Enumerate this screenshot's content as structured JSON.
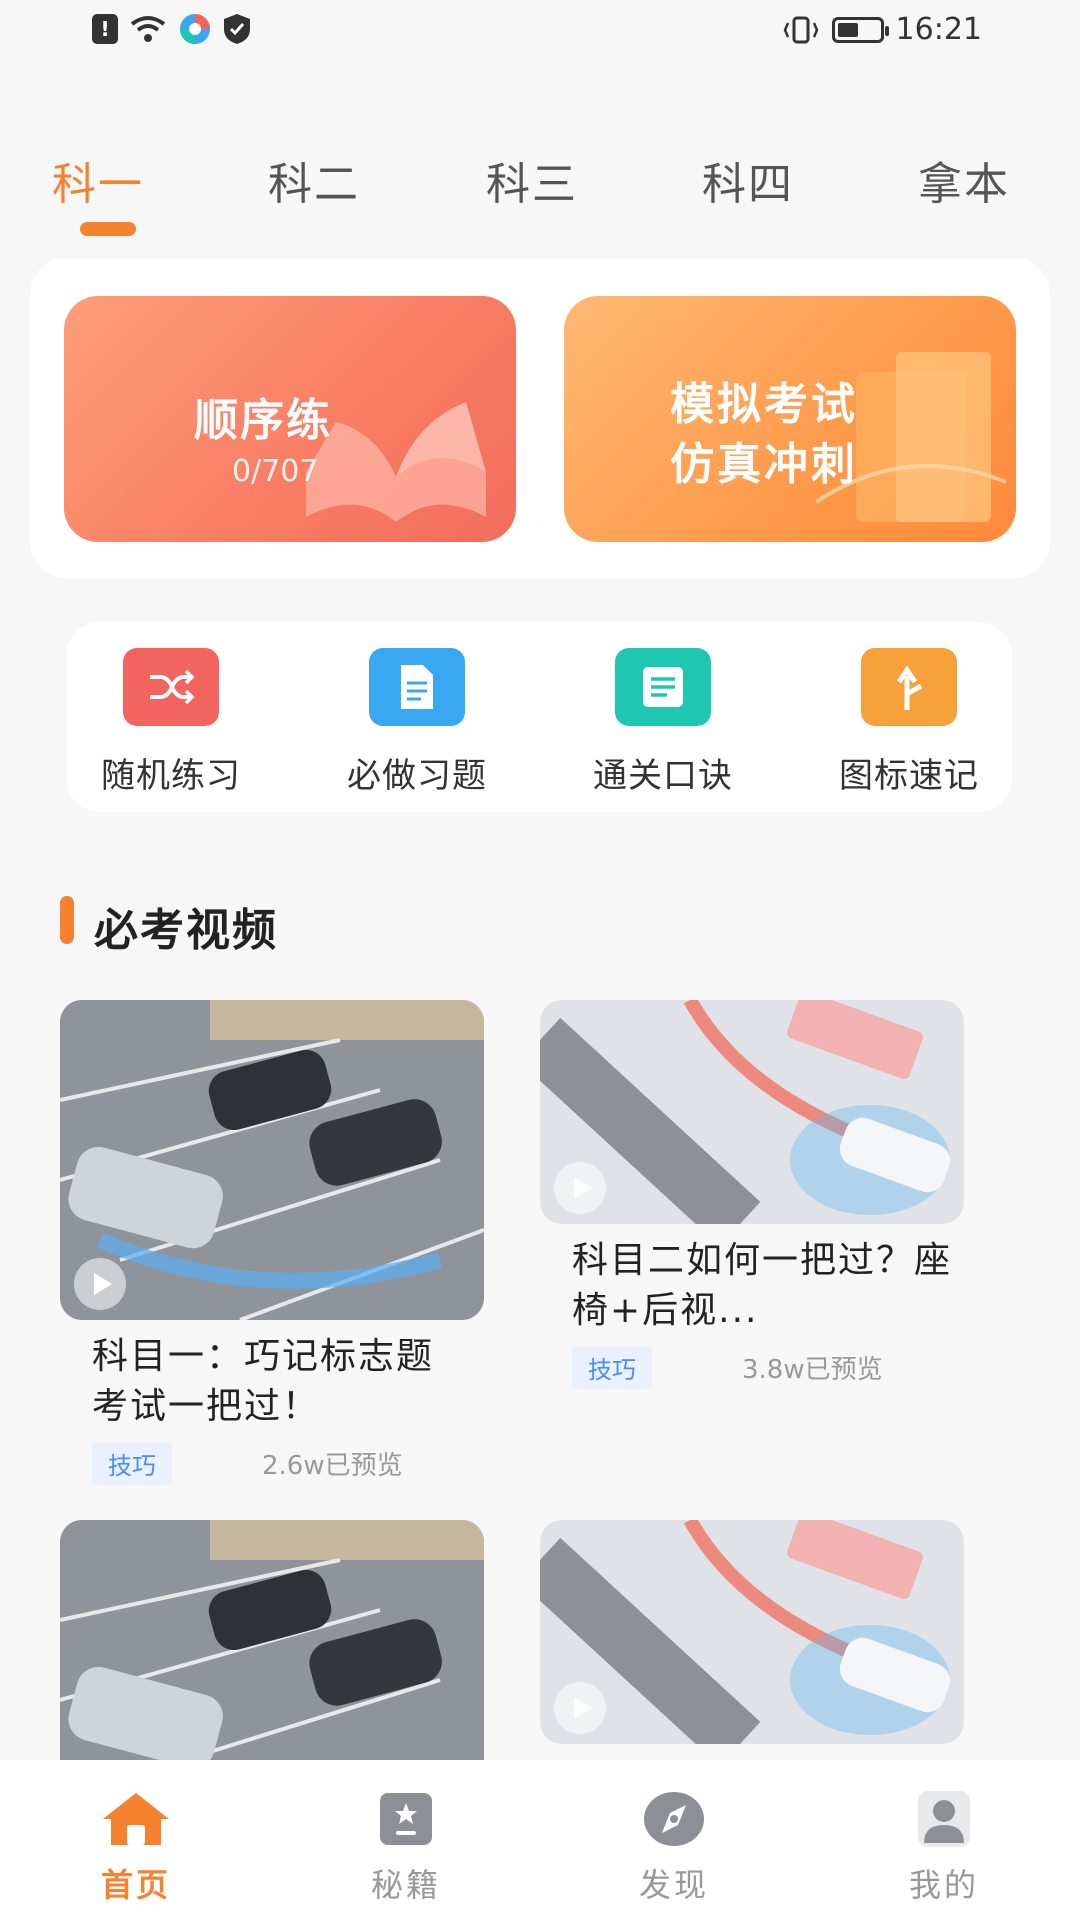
{
  "status_bar": {
    "time": "16:21",
    "icons": [
      "alert-icon",
      "wifi-icon",
      "app-icon",
      "shield-icon",
      "vibrate-icon",
      "battery-icon"
    ]
  },
  "tabs": [
    {
      "label": "科一",
      "active": true
    },
    {
      "label": "科二",
      "active": false
    },
    {
      "label": "科三",
      "active": false
    },
    {
      "label": "科四",
      "active": false
    },
    {
      "label": "拿本",
      "active": false
    }
  ],
  "cards": {
    "sequential": {
      "title": "顺序练",
      "count": "0/707"
    },
    "mock_exam": {
      "line1": "模拟考试",
      "line2": "仿真冲刺"
    }
  },
  "tools": [
    {
      "label": "随机练习",
      "icon": "shuffle-icon",
      "color": "#f4645f"
    },
    {
      "label": "必做习题",
      "icon": "document-icon",
      "color": "#3aa7f2"
    },
    {
      "label": "通关口诀",
      "icon": "notes-icon",
      "color": "#1ec8b0"
    },
    {
      "label": "图标速记",
      "icon": "sign-icon",
      "color": "#f7a13a"
    }
  ],
  "section": {
    "title": "必考视频"
  },
  "videos": [
    {
      "title": "科目一：巧记标志题 考试一把过！",
      "tag": "技巧",
      "views": "2.6w已预览"
    },
    {
      "title": "科目二如何一把过？座椅+后视...",
      "tag": "技巧",
      "views": "3.8w已预览"
    },
    {
      "title": "",
      "tag": "",
      "views": ""
    },
    {
      "title": "",
      "tag": "",
      "views": ""
    }
  ],
  "bottom_nav": [
    {
      "label": "首页",
      "icon": "home-icon",
      "active": true
    },
    {
      "label": "秘籍",
      "icon": "book-icon",
      "active": false
    },
    {
      "label": "发现",
      "icon": "compass-icon",
      "active": false
    },
    {
      "label": "我的",
      "icon": "profile-icon",
      "active": false
    }
  ],
  "colors": {
    "accent": "#f5822f",
    "tag_bg": "#e9f1ff",
    "tag_text": "#4e8af2"
  }
}
